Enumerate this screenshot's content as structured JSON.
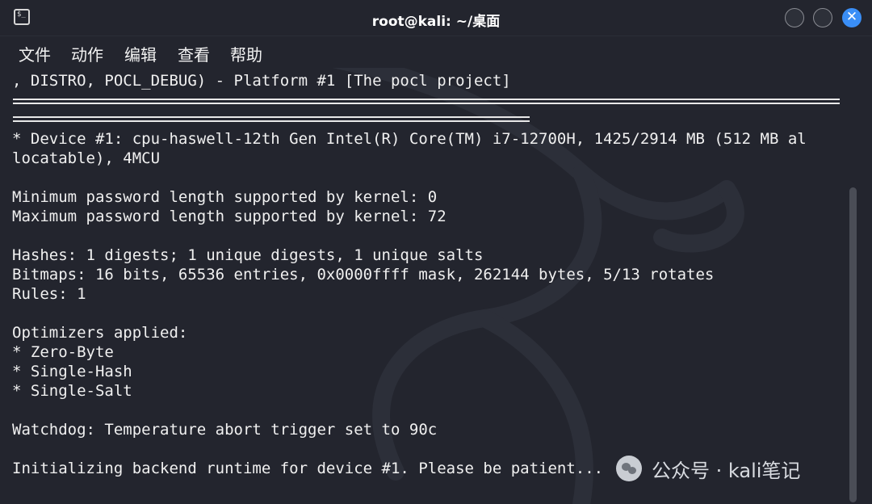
{
  "window": {
    "title": "root@kali: ~/桌面",
    "icon": "terminal-icon",
    "controls": {
      "minimize": "",
      "maximize": "",
      "close": "✕"
    }
  },
  "menu": [
    "文件",
    "动作",
    "编辑",
    "查看",
    "帮助"
  ],
  "terminal": {
    "lines": {
      "platform": ", DISTRO, POCL_DEBUG) - Platform #1 [The pocl project]",
      "device_1": "* Device #1: cpu-haswell-12th Gen Intel(R) Core(TM) i7-12700H, 1425/2914 MB (512 MB al",
      "device_2": "locatable), 4MCU",
      "min_pw": "Minimum password length supported by kernel: 0",
      "max_pw": "Maximum password length supported by kernel: 72",
      "hashes": "Hashes: 1 digests; 1 unique digests, 1 unique salts",
      "bitmaps": "Bitmaps: 16 bits, 65536 entries, 0x0000ffff mask, 262144 bytes, 5/13 rotates",
      "rules": "Rules: 1",
      "optimizers": "Optimizers applied:",
      "opt_1": "* Zero-Byte",
      "opt_2": "* Single-Hash",
      "opt_3": "* Single-Salt",
      "watchdog": "Watchdog: Temperature abort trigger set to 90c",
      "init": "Initializing backend runtime for device #1. Please be patient..."
    }
  },
  "watermark": {
    "text": "公众号 · kali笔记"
  }
}
